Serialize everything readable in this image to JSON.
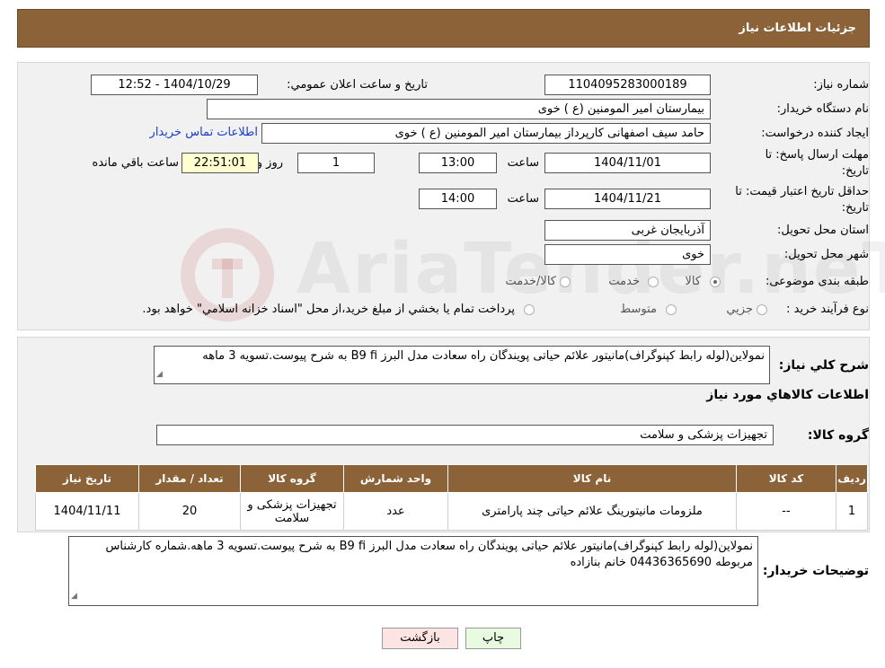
{
  "header": {
    "title": "جزئيات اطلاعات نياز"
  },
  "form": {
    "need_number": {
      "label": "شماره نياز:",
      "value": "1104095283000189"
    },
    "announce": {
      "label": "تاريخ و ساعت اعلان عمومي:",
      "value": "1404/10/29 - 12:52"
    },
    "buyer_org": {
      "label": "نام دستگاه خريدار:",
      "value": "بیمارستان امیر المومنین (ع ) خوی"
    },
    "requester": {
      "label": "ايجاد کننده درخواست:",
      "value": "حامد سیف اصفهانی کارپرداز بیمارستان امیر المومنین (ع ) خوی",
      "contact_link": "اطلاعات تماس خريدار"
    },
    "reply_deadline": {
      "label_line1": "مهلت ارسال پاسخ: تا",
      "label_line2": "تاريخ:",
      "date": "1404/11/01",
      "time_label": "ساعت",
      "time": "13:00",
      "days": "1",
      "days_label": "روز و",
      "remaining": "22:51:01",
      "remaining_label": "ساعت باقي مانده"
    },
    "price_validity": {
      "label_line1": "حداقل تاريخ اعتبار قيمت: تا",
      "label_line2": "تاريخ:",
      "date": "1404/11/21",
      "time_label": "ساعت",
      "time": "14:00"
    },
    "province": {
      "label": "استان محل تحويل:",
      "value": "آذربایجان غربی"
    },
    "city": {
      "label": "شهر محل تحويل:",
      "value": "خوی"
    },
    "category": {
      "label": "طبقه بندی موضوعی:",
      "options": [
        "کالا",
        "خدمت",
        "کالا/خدمت"
      ],
      "selected": "کالا"
    },
    "purchase_process": {
      "label": "نوع فرآيند خريد :",
      "options": [
        "جزيي",
        "متوسط"
      ],
      "note": "پرداخت تمام يا بخشي از مبلغ خريد،از محل \"اسناد خزانه اسلامي\" خواهد بود."
    }
  },
  "description": {
    "label": "شرح کلي نياز:",
    "value": "نمولاین(لوله رابط کپنوگراف)مانیتور علائم حیاتی پویندگان راه سعادت مدل البرز B9 fi به شرح پیوست.تسویه 3 ماهه"
  },
  "goods_info": {
    "title": "اطلاعات کالاهاي مورد نياز",
    "group_label": "گروه کالا:",
    "group_value": "تجهیزات پزشکی و سلامت"
  },
  "table": {
    "headers": [
      "رديف",
      "کد کالا",
      "نام کالا",
      "واحد شمارش",
      "تعداد / مقدار",
      "تاريخ نياز"
    ],
    "rows": [
      {
        "row": "1",
        "code": "--",
        "name": "ملزومات مانیتورینگ علائم حیاتی چند پارامتری",
        "unit": "عدد",
        "group": "تجهیزات پزشکی و سلامت",
        "qty": "20",
        "date": "1404/11/11"
      }
    ],
    "group_header": "گروه کالا"
  },
  "buyer_notes": {
    "label": "توضيحات خريدار:",
    "value": "نمولاین(لوله رابط کپنوگراف)مانیتور علائم حیاتی پویندگان راه سعادت مدل البرز B9 fi به شرح پیوست.تسویه 3 ماهه.شماره کارشناس مربوطه 04436365690 خانم بنازاده"
  },
  "buttons": {
    "print": "چاپ",
    "back": "بازگشت"
  },
  "watermark": {
    "text": "AriaTender.neT"
  },
  "colors": {
    "header_bg": "#8c6339",
    "panel_bg": "#f1f1f1",
    "link": "#1a3cc6",
    "back_btn": "#fde4e4",
    "print_btn": "#e8fbe0"
  }
}
